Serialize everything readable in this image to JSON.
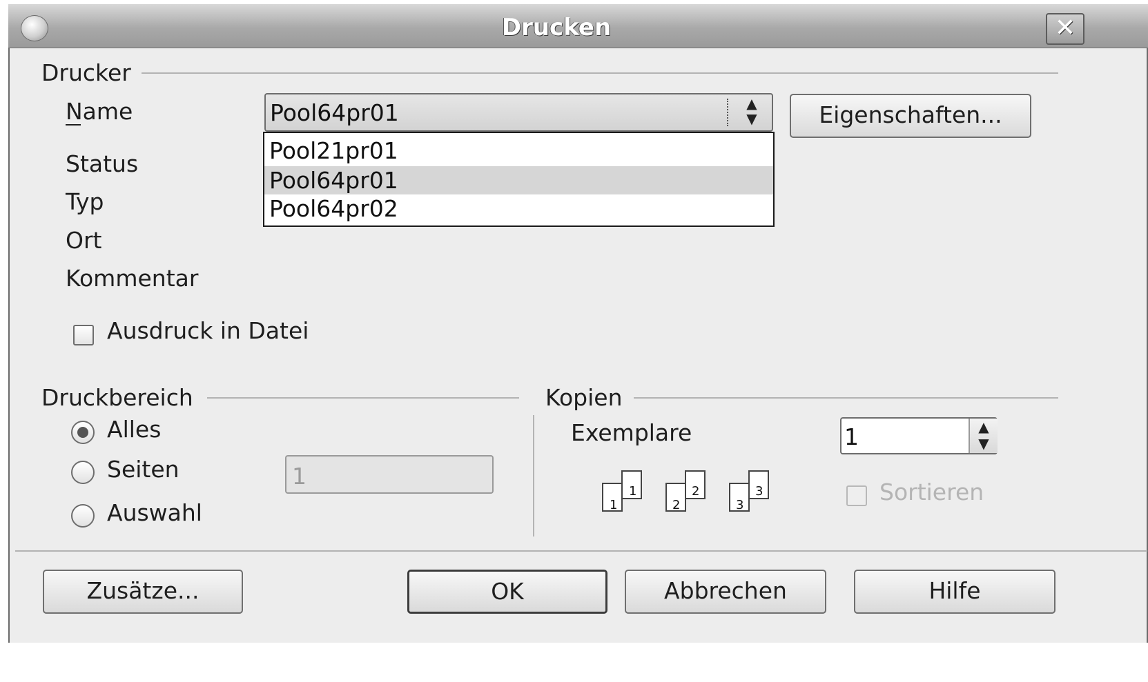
{
  "window": {
    "title": "Drucken"
  },
  "printer": {
    "section_label": "Drucker",
    "name_label": "Name",
    "name_value": "Pool64pr01",
    "dropdown_options": [
      "Pool21pr01",
      "Pool64pr01",
      "Pool64pr02"
    ],
    "selected_option": "Pool64pr01",
    "properties_button": "Eigenschaften...",
    "status_label": "Status",
    "type_label": "Typ",
    "location_label": "Ort",
    "comment_label": "Kommentar",
    "print_to_file_label": "Ausdruck in Datei",
    "print_to_file_checked": false
  },
  "print_range": {
    "section_label": "Druckbereich",
    "options": [
      "Alles",
      "Seiten",
      "Auswahl"
    ],
    "selected": "Alles",
    "pages_value": "1"
  },
  "copies": {
    "section_label": "Kopien",
    "count_label": "Exemplare",
    "count_value": "1",
    "collate_label": "Sortieren",
    "collate_checked": false,
    "collate_enabled": false,
    "page_icons": [
      "1",
      "1",
      "2",
      "2",
      "3",
      "3"
    ]
  },
  "buttons": {
    "options": "Zusätze...",
    "ok": "OK",
    "cancel": "Abbrechen",
    "help": "Hilfe"
  },
  "icons": {
    "window": "app-icon",
    "close": "close-icon",
    "combo_arrows": "up-down-arrows-icon",
    "collate_preview": "collated-pages-icon"
  }
}
